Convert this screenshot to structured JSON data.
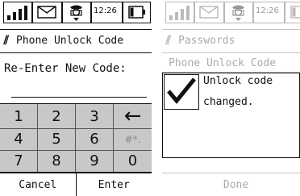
{
  "left_screen": {
    "status_bar": {
      "time": "12:26",
      "icons": [
        "signal-icon",
        "mail-icon",
        "phone-icon",
        "battery-icon"
      ]
    },
    "title": "Phone Unlock Code",
    "title_icon": "tools-icon",
    "prompt": "Re-Enter New Code:",
    "code_value": "",
    "keypad": {
      "keys": [
        "1",
        "2",
        "3",
        "←",
        "4",
        "5",
        "6",
        "#*.",
        "7",
        "8",
        "9",
        "0"
      ],
      "disabled_key": "#*."
    },
    "soft_buttons": {
      "left": "Cancel",
      "right": "Enter"
    }
  },
  "right_screen": {
    "status_bar": {
      "time": "12:26",
      "icons": [
        "signal-icon",
        "mail-icon",
        "phone-icon",
        "battery-icon"
      ]
    },
    "title": "Passwords",
    "title_icon": "tools-icon",
    "section": "Phone Unlock Code",
    "message_lines": [
      "Unlock code",
      "changed."
    ],
    "message_icon": "checkmark-icon",
    "done_label": "Done"
  }
}
